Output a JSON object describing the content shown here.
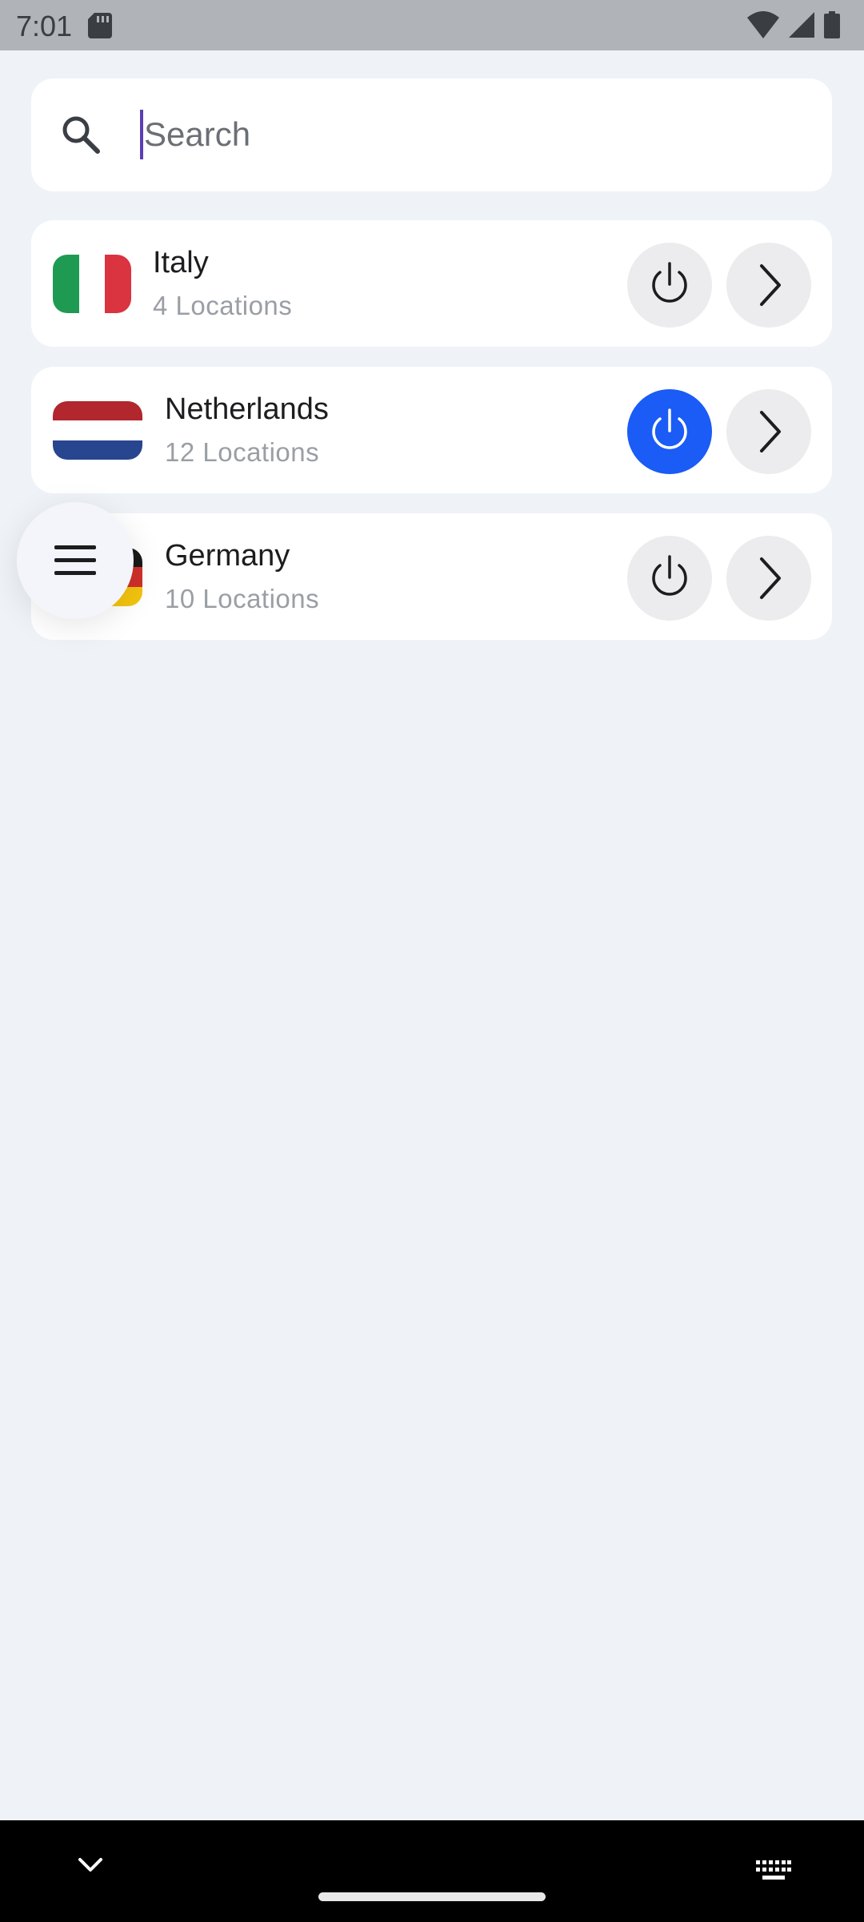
{
  "status_bar": {
    "time": "7:01",
    "icons": [
      "sd-card-icon",
      "wifi-icon",
      "signal-icon",
      "battery-icon"
    ]
  },
  "search": {
    "placeholder": "Search",
    "value": "",
    "icon": "search-icon"
  },
  "countries": [
    {
      "name": "Italy",
      "locations": "4 Locations",
      "flag_colors": [
        "#1f9a53",
        "#ffffff",
        "#d9343f"
      ],
      "connected": false
    },
    {
      "name": "Netherlands",
      "locations": "12 Locations",
      "flag_colors": [
        "#b2262e",
        "#ffffff",
        "#28458f"
      ],
      "connected": true
    },
    {
      "name": "Germany",
      "locations": "10 Locations",
      "flag_colors": [
        "#1a1a1a",
        "#d0302b",
        "#f3c40f"
      ],
      "connected": false
    }
  ],
  "fab": {
    "icon": "menu-icon"
  },
  "colors": {
    "background": "#eff3f8",
    "card": "#ffffff",
    "accent": "#1a5cf5",
    "button_bg": "#ececee"
  },
  "nav_bar": {
    "icons": [
      "chevron-down-icon",
      "keyboard-icon"
    ]
  }
}
